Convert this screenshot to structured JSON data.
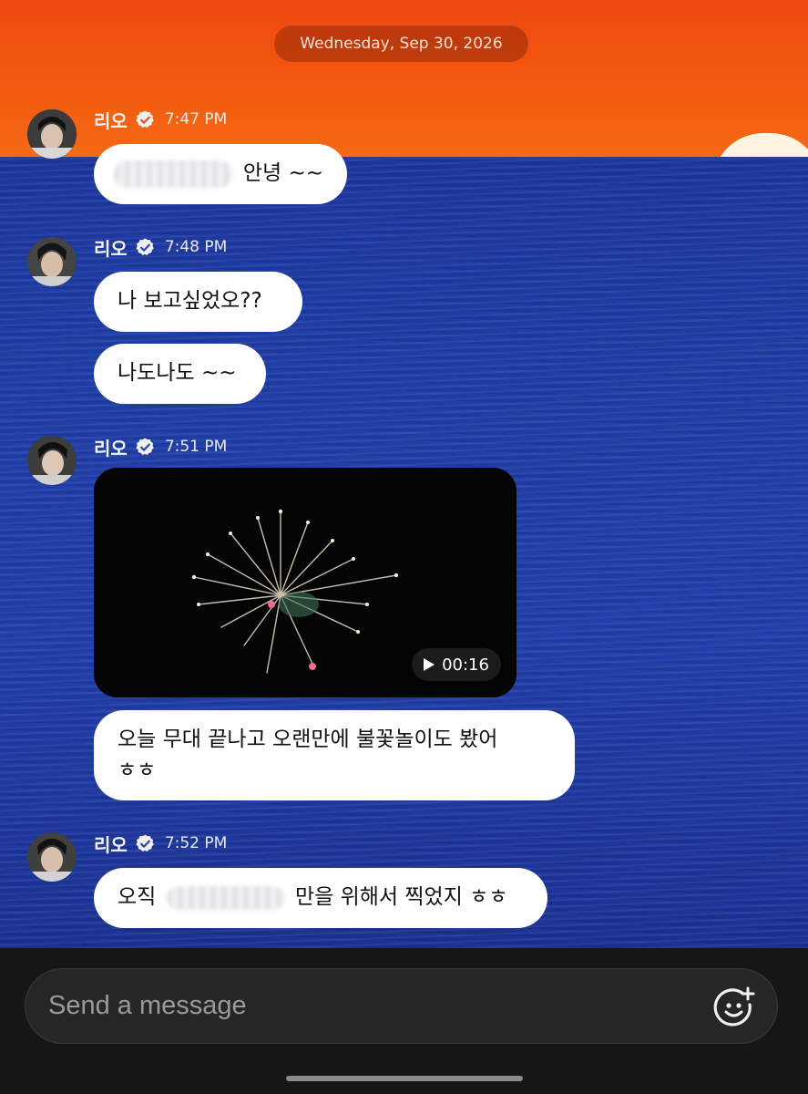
{
  "date_divider": "Wednesday, Sep 30, 2026",
  "messages": [
    {
      "sender": "리오",
      "time": "7:47 PM",
      "bubbles": [
        {
          "text": "안녕 ~~"
        }
      ]
    },
    {
      "sender": "리오",
      "time": "7:48 PM",
      "bubbles": [
        {
          "text": "나 보고싶었오??"
        },
        {
          "text": "나도나도 ~~"
        }
      ]
    },
    {
      "sender": "리오",
      "time": "7:51 PM",
      "video": {
        "duration": "00:16"
      },
      "bubbles": [
        {
          "text": "오늘 무대 끝나고 오랜만에 불꽃놀이도 봤어\nㅎㅎ"
        }
      ]
    },
    {
      "sender": "리오",
      "time": "7:52 PM",
      "bubbles": [
        {
          "text_before": "오직",
          "text_after": "만을 위해서 찍었지 ㅎㅎ"
        }
      ]
    }
  ],
  "composer": {
    "placeholder": "Send a message"
  },
  "icons": {
    "verified": "verified-badge-icon",
    "sticker": "sticker-add-icon",
    "play": "play-icon"
  },
  "colors": {
    "bubble": "#ffffff",
    "sky": "#ef4f11",
    "sea": "#1f3ca6",
    "bottom_bar": "#161616"
  }
}
